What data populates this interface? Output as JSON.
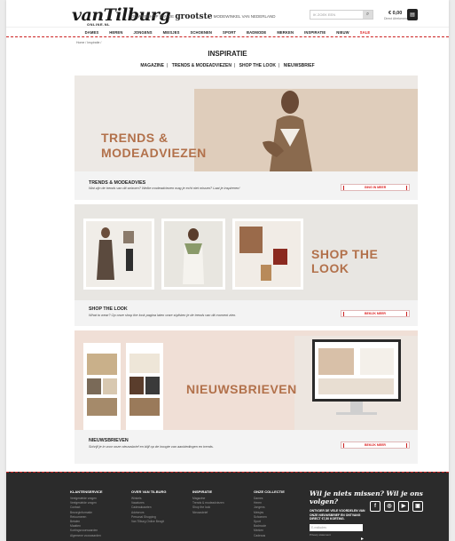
{
  "header": {
    "logo_text": "vanTilburg",
    "logo_sub": "ONLINE.NL",
    "tagline_prefix": "DE WEBSHOP VAN DE",
    "tagline_big": "grootste",
    "tagline_suffix": "MODEWINKEL VAN NEDERLAND",
    "search_placeholder": "IK ZOEK EEN",
    "cart_price": "€ 0,00",
    "cart_sub": "Direct Afrekenen"
  },
  "nav": [
    "DAMES",
    "HEREN",
    "JONGENS",
    "MEISJES",
    "SCHOENEN",
    "SPORT",
    "BADMODE",
    "MERKEN",
    "INSPIRATIE",
    "NIEUW",
    "SALE"
  ],
  "breadcrumb": "Home / Inspiratie /",
  "page_title": "INSPIRATIE",
  "subnav": [
    "MAGAZINE",
    "TRENDS & MODEADVIEZEN",
    "SHOP THE LOOK",
    "NIEUWSBRIEF"
  ],
  "cards": [
    {
      "banner_line1": "TRENDS &",
      "banner_line2": "MODEADVIEZEN",
      "title": "TRENDS & MODEADVIES",
      "desc": "Wat zijn de trends van dit seizoen? Welke modeadviezen mag je echt niet missen? Laat je inspireren!",
      "button": "GING IN MEER"
    },
    {
      "banner": "SHOP THE LOOK",
      "title": "SHOP THE LOOK",
      "desc": "What to wear? Op onze shop the look pagina laten onze stylisten je de trends van dit moment zien.",
      "button": "BEKIJK MEER"
    },
    {
      "banner": "NIEUWSBRIEVEN",
      "title": "NIEUWSBRIEVEN",
      "desc": "Schrijf je in voor onze nieuwsbrief en blijf op de hoogte van aanbiedingen en trends.",
      "button": "BEKIJK MEER"
    }
  ],
  "footer": {
    "columns": [
      {
        "heading": "KLANTENSERVICE",
        "links": [
          "Veelgestelde vragen",
          "Veelgestelde vragen",
          "Contact",
          "Bezorginformatie",
          "Retourneren",
          "Betalen",
          "Maatten",
          "Kortingsvoorwaarden",
          "Algemene voorwaarden"
        ]
      },
      {
        "heading": "OVER VAN TILBURG",
        "links": [
          "Winkels",
          "Vacatures",
          "Cadeaukaarten",
          "Adviseurs",
          "Personal Shopping",
          "Van Tilburg Online Bezgit"
        ]
      },
      {
        "heading": "INSPIRATIE",
        "links": [
          "Magazine",
          "Trends & modeadviezen",
          "Shop the look",
          "Nieuwsbrief"
        ]
      },
      {
        "heading": "ONZE COLLECTIE",
        "links": [
          "Dames",
          "Heren",
          "Jongens",
          "Meisjes",
          "Schoenen",
          "Sport",
          "Badmode",
          "Merken",
          "Cadeaus"
        ]
      }
    ],
    "slogan": "Wil je niets missen?  Wil je ons volgen?",
    "newsletter_text": "ONTVOER DE VELE VOORDELEN VAN ONZE NIEUWSBRIEF EN ONTVANG DIRECT €7,50 KORTING.",
    "email_placeholder": "E-mailadres",
    "privacy": "Privacy statement",
    "social": [
      "f",
      "◎",
      "▶",
      "▣"
    ]
  },
  "colors": {
    "accent": "#d22222",
    "banner_text": "#b2714b",
    "footer_bg": "#2b2b2b"
  }
}
